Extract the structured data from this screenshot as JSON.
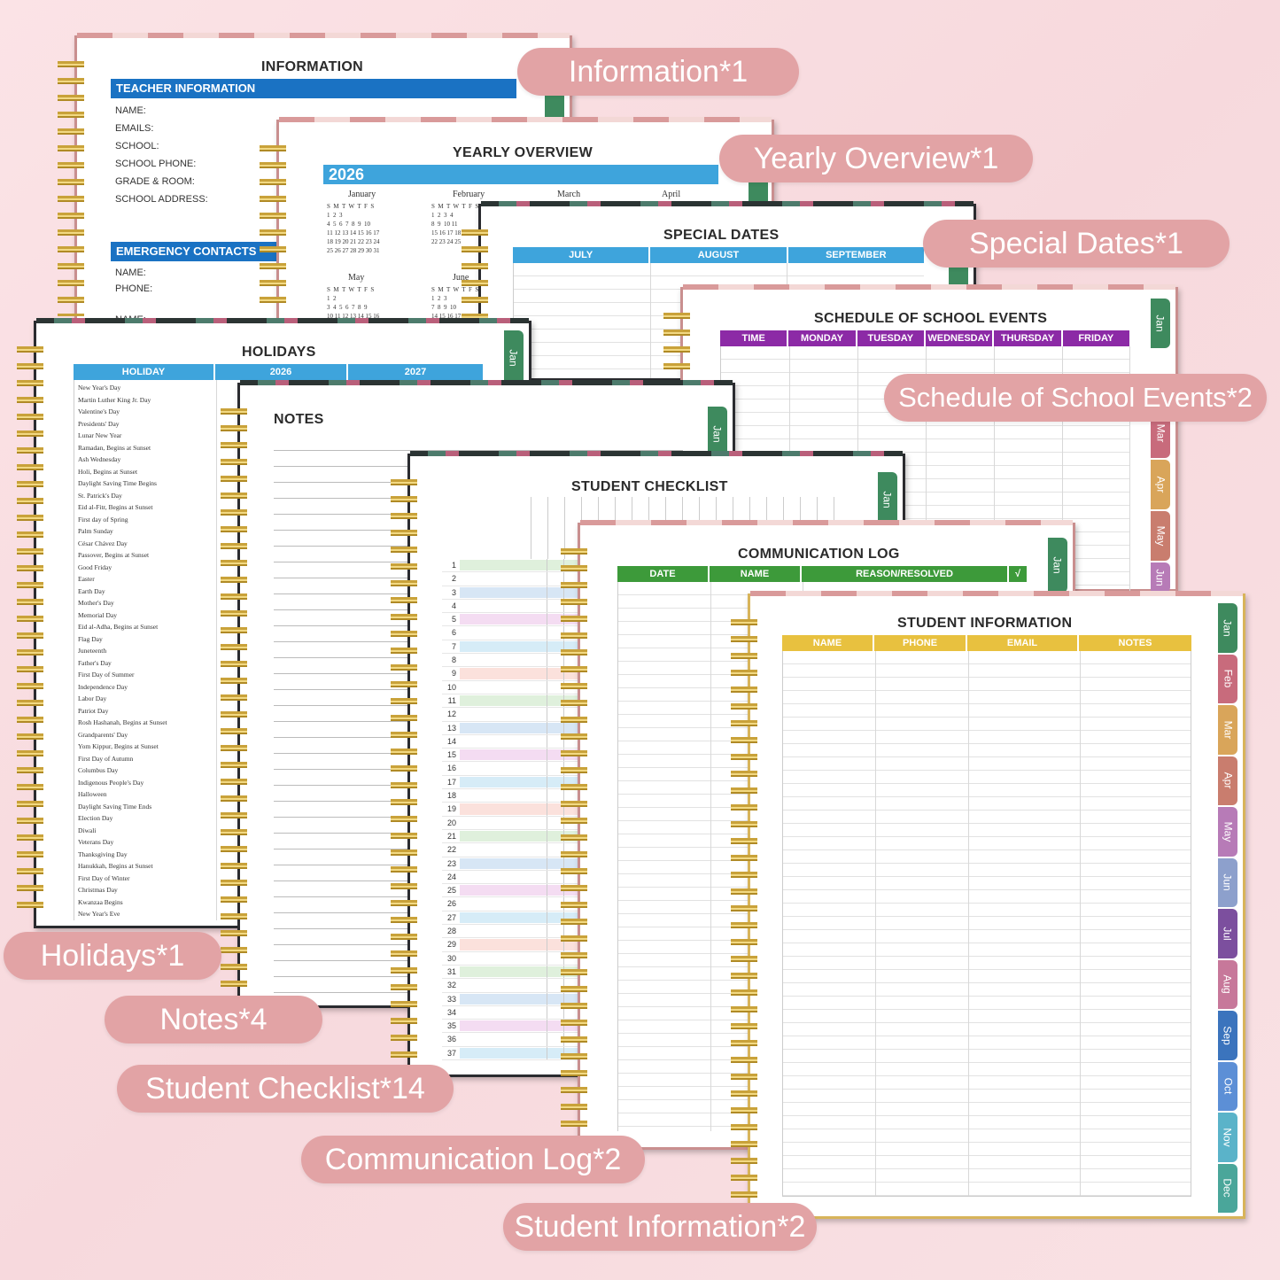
{
  "information": {
    "title": "INFORMATION",
    "teacher_header": "TEACHER INFORMATION",
    "fields": [
      "NAME:",
      "EMAILS:",
      "SCHOOL:",
      "SCHOOL PHONE:",
      "GRADE & ROOM:",
      "SCHOOL ADDRESS:"
    ],
    "emergency_header": "EMERGENCY CONTACTS",
    "emergency_fields": [
      "NAME:",
      "PHONE:"
    ],
    "cut_field": "NAME:"
  },
  "yearly": {
    "title": "YEARLY OVERVIEW",
    "year": "2026",
    "months_row1": [
      "January",
      "February",
      "March",
      "April"
    ],
    "months_row2": [
      "May",
      "June"
    ],
    "weekdays": "S  M  T  W  T  F  S",
    "jan_rows": [
      "1  2  3",
      "4  5  6  7  8  9  10",
      "11 12 13 14 15 16 17",
      "18 19 20 21 22 23 24",
      "25 26 27 28 29 30 31"
    ],
    "feb_rows": [
      "1  2  3  4",
      "8  9  10 11",
      "15 16 17 18",
      "22 23 24 25"
    ],
    "may_rows": [
      "1  2",
      "3  4  5  6  7  8  9",
      "10 11 12 13 14 15 16"
    ],
    "jun_rows": [
      "1  2  3",
      "7  8  9  10",
      "14 15 16 17"
    ]
  },
  "special": {
    "title": "SPECIAL DATES",
    "columns": [
      "JULY",
      "AUGUST",
      "SEPTEMBER"
    ]
  },
  "schedule": {
    "title": "SCHEDULE OF SCHOOL EVENTS",
    "columns": [
      "TIME",
      "MONDAY",
      "TUESDAY",
      "WEDNESDAY",
      "THURSDAY",
      "FRIDAY"
    ],
    "tabs": [
      "Jan",
      "Mar",
      "Apr",
      "May",
      "Jun"
    ]
  },
  "holidays": {
    "title": "HOLIDAYS",
    "columns": [
      "HOLIDAY",
      "2026",
      "2027"
    ],
    "tab": "Jan",
    "items": [
      "New Year's Day",
      "Martin Luther King Jr. Day",
      "Valentine's Day",
      "Presidents' Day",
      "Lunar New Year",
      "Ramadan, Begins at Sunset",
      "Ash Wednesday",
      "Holi, Begins at Sunset",
      "Daylight Saving Time Begins",
      "St. Patrick's Day",
      "Eid al-Fitr, Begins at Sunset",
      "First day of Spring",
      "Palm Sunday",
      "César Chávez Day",
      "Passover, Begins at Sunset",
      "Good Friday",
      "Easter",
      "Earth Day",
      "Mother's Day",
      "Memorial Day",
      "Eid al-Adha, Begins at Sunset",
      "Flag Day",
      "Juneteenth",
      "Father's Day",
      "First Day of Summer",
      "Independence Day",
      "Labor Day",
      "Patriot Day",
      "Rosh Hashanah, Begins at Sunset",
      "Grandparents' Day",
      "Yom Kippur, Begins at Sunset",
      "First Day of Autumn",
      "Columbus Day",
      "Indigenous People's Day",
      "Halloween",
      "Daylight Saving Time Ends",
      "Election Day",
      "Diwali",
      "Veterans Day",
      "Thanksgiving Day",
      "Hanukkah, Begins at Sunset",
      "First Day of Winter",
      "Christmas Day",
      "Kwanzaa Begins",
      "New Year's Eve"
    ]
  },
  "notes": {
    "title": "NOTES",
    "tab": "Jan"
  },
  "checklist": {
    "title": "STUDENT CHECKLIST",
    "tab": "Jan",
    "rows": 37
  },
  "commlog": {
    "title": "COMMUNICATION LOG",
    "columns": [
      "DATE",
      "NAME",
      "REASON/RESOLVED",
      "√"
    ],
    "tab": "Jan"
  },
  "studentinfo": {
    "title": "STUDENT INFORMATION",
    "columns": [
      "NAME",
      "PHONE",
      "EMAIL",
      "NOTES"
    ],
    "tabs": [
      "Jan",
      "Feb",
      "Mar",
      "Apr",
      "May",
      "Jun",
      "Jul",
      "Aug",
      "Sep",
      "Oct",
      "Nov",
      "Dec"
    ]
  },
  "labels": {
    "information": "Information*1",
    "yearly": "Yearly Overview*1",
    "special": "Special Dates*1",
    "schedule": "Schedule of School Events*2",
    "holidays": "Holidays*1",
    "notes": "Notes*4",
    "checklist": "Student Checklist*14",
    "commlog": "Communication Log*2",
    "studentinfo": "Student Information*2"
  },
  "colors": {
    "blue_dark": "#1a72c3",
    "blue_light": "#3ea4dc",
    "purple": "#8c2aa6",
    "green": "#3d9a3a",
    "yellow": "#e8c13f",
    "label_pink": "#e2a3a5"
  },
  "tab_colors": [
    "#3e8a5e",
    "#c86b7c",
    "#d9a55a",
    "#c97d6e",
    "#b77bb7",
    "#8da0cc",
    "#7c4f9e",
    "#c7789a",
    "#3b74bd",
    "#5c8fd6",
    "#5ab3c9",
    "#4aa69a"
  ]
}
